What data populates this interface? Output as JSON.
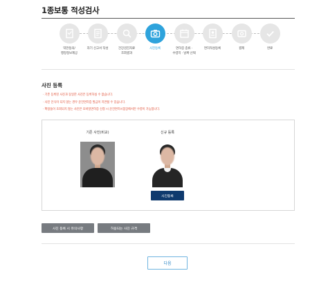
{
  "page": {
    "title": "1종보통 적성검사"
  },
  "steps": [
    {
      "label": "약관동의/\n행정정보제공",
      "icon": "document-check-icon",
      "state": "done"
    },
    {
      "label": "자기 신고서 작성",
      "icon": "form-icon",
      "state": "done"
    },
    {
      "label": "건강검진자료\n조회결과",
      "icon": "search-document-icon",
      "state": "done"
    },
    {
      "label": "사진등록",
      "icon": "camera-icon",
      "state": "active"
    },
    {
      "label": "면허증 종류 ·\n수령지 · 날짜 선택",
      "icon": "calendar-icon",
      "state": "pending"
    },
    {
      "label": "면허적성등록",
      "icon": "license-icon",
      "state": "pending"
    },
    {
      "label": "결제",
      "icon": "payment-icon",
      "state": "pending"
    },
    {
      "label": "완료",
      "icon": "checkmark-icon",
      "state": "pending"
    }
  ],
  "section": {
    "title": "사진 등록",
    "notices": [
      "· 기존 등록된 사진과 동일한 사진은 등록하실 수 없습니다.",
      "· 사진 인식이 되지 않는 경우 운전면허증 발급이 지연될 수 있습니다.",
      "· 확정들이 조회되지 않는 사진은 모바일면허증 신청 시 운전면허시험장에서만 수령이 가능합니다."
    ]
  },
  "photos": {
    "existing_label": "기존 사진(비교)",
    "new_label": "신규 등록",
    "register_button": "사진등록"
  },
  "buttons": {
    "precautions": "사진 등록 시 유의사항",
    "allowed": "허용되는 사진 규격",
    "next": "다음"
  },
  "colors": {
    "active_step": "#2ea3dc",
    "inactive_step": "#e6e6e6",
    "notice_text": "#e0533a",
    "register_button": "#0f3a6e",
    "gray_button": "#777b80",
    "next_border": "#6fb4e0"
  }
}
